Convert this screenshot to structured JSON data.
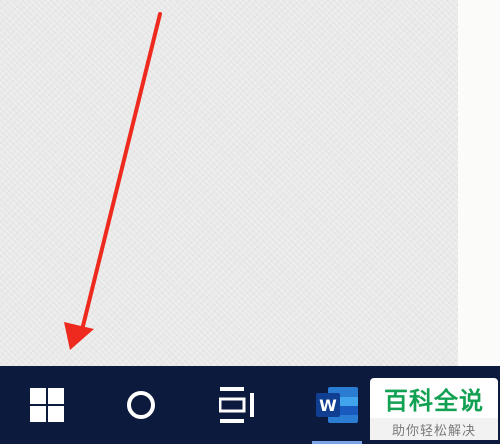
{
  "taskbar": {
    "start_button": {
      "icon": "windows-logo-icon"
    },
    "search_button": {
      "icon": "cortana-circle-icon"
    },
    "task_view_button": {
      "icon": "task-view-icon"
    },
    "word_app": {
      "icon": "word-icon",
      "letter": "W",
      "active": true
    }
  },
  "annotation": {
    "arrow_color": "#ee2a1e"
  },
  "watermark": {
    "title": "百科全说",
    "subtitle": "助你轻松解决",
    "title_color": "#12a152"
  },
  "colors": {
    "taskbar_bg": "#0c1a3d",
    "desktop_bg": "#e9e9e9",
    "word_blue": "#185abd"
  }
}
